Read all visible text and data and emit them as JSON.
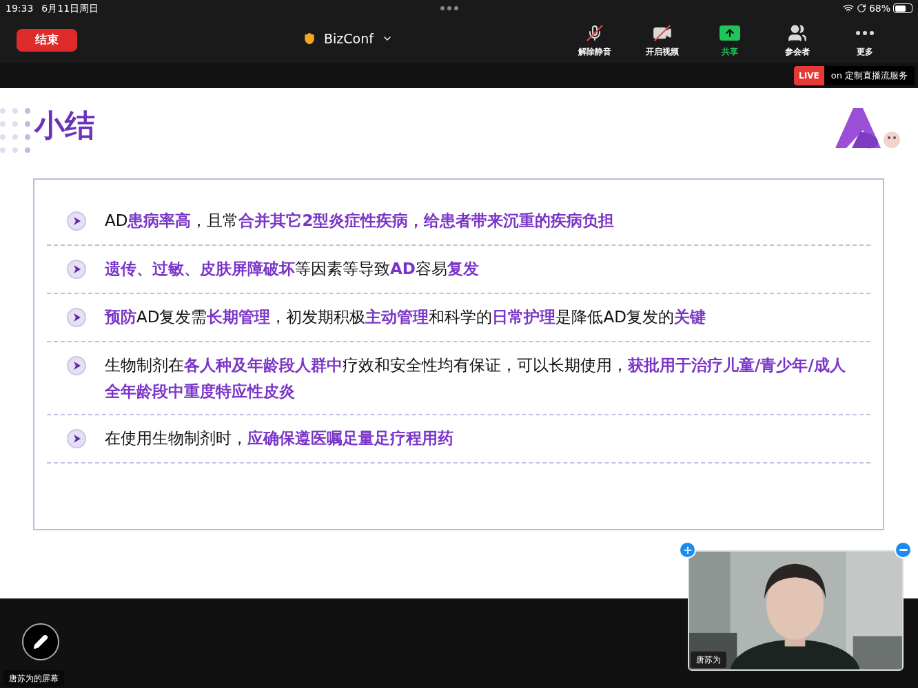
{
  "status_bar": {
    "time": "19:33",
    "date": "6月11日周日",
    "battery": "68%"
  },
  "toolbar": {
    "end_button": "结束",
    "meeting_title": "BizConf",
    "buttons": [
      {
        "kind": "mic",
        "label": "解除静音",
        "off": true
      },
      {
        "kind": "video",
        "label": "开启视频",
        "off": true
      },
      {
        "kind": "share",
        "label": "共享"
      },
      {
        "kind": "participants",
        "label": "参会者"
      },
      {
        "kind": "more",
        "label": "更多"
      }
    ]
  },
  "live": {
    "badge": "LIVE",
    "text": "on 定制直播流服务"
  },
  "slide": {
    "title": "小结",
    "items": [
      {
        "text": "AD**患病率高**，且常**合并其它2型炎症性疾病，给患者带来沉重的疾病负担**"
      },
      {
        "text": "**遗传、过敏、皮肤屏障破坏**等因素等导致**AD**容易**复发**"
      },
      {
        "text": "**预防**AD复发需**长期管理**，初发期积极**主动管理**和科学的**日常护理**是降低AD复发的**关键**"
      },
      {
        "text": "生物制剂在**各人种及年龄段人群中**疗效和安全性均有保证，可以长期使用，**获批用于治疗儿童/青少年/成人全年龄段中重度特应性皮炎**"
      },
      {
        "text": "在使用生物制剂时，**应确保遵医嘱足量足疗程用药**"
      }
    ]
  },
  "video": {
    "name": "唐苏为"
  },
  "share_label": "唐苏为的屏幕"
}
